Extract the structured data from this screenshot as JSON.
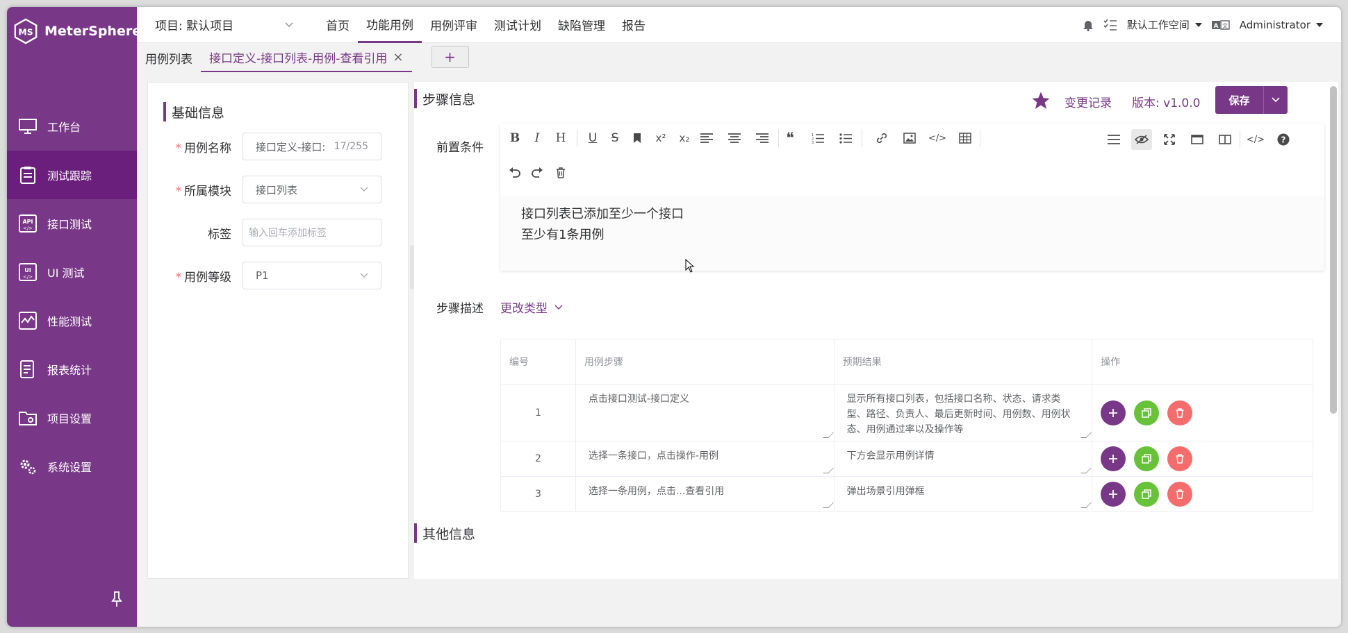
{
  "app": {
    "name": "MeterSphere"
  },
  "sidebar": {
    "items": [
      {
        "label": "工作台"
      },
      {
        "label": "测试跟踪"
      },
      {
        "label": "接口测试"
      },
      {
        "label": "UI 测试"
      },
      {
        "label": "性能测试"
      },
      {
        "label": "报表统计"
      },
      {
        "label": "项目设置"
      },
      {
        "label": "系统设置"
      }
    ]
  },
  "header": {
    "project": "项目: 默认项目",
    "menu": [
      "首页",
      "功能用例",
      "用例评审",
      "测试计划",
      "缺陷管理",
      "报告"
    ],
    "workspace": "默认工作空间",
    "user": "Administrator"
  },
  "tabs": {
    "list": "用例列表",
    "active": "接口定义-接口列表-用例-查看引用",
    "close": "×",
    "add": "+"
  },
  "basic": {
    "title": "基础信息",
    "name_label": "用例名称",
    "name_value": "接口定义-接口:",
    "name_count": "17/255",
    "module_label": "所属模块",
    "module_value": "接口列表",
    "tag_label": "标签",
    "tag_placeholder": "输入回车添加标签",
    "level_label": "用例等级",
    "level_value": "P1",
    "required": "*"
  },
  "steps": {
    "title": "步骤信息",
    "history": "变更记录",
    "version": "版本: v1.0.0",
    "save": "保存",
    "precondition_label": "前置条件",
    "precondition_lines": [
      "接口列表已添加至少一个接口",
      "至少有1条用例"
    ],
    "desc_label": "步骤描述",
    "change_type": "更改类型",
    "columns": [
      "编号",
      "用例步骤",
      "预期结果",
      "操作"
    ],
    "rows": [
      {
        "num": "1",
        "step": "点击接口测试-接口定义",
        "expected": "显示所有接口列表，包括接口名称、状态、请求类型、路径、负责人、最后更新时间、用例数、用例状态、用例通过率以及操作等"
      },
      {
        "num": "2",
        "step": "选择一条接口，点击操作-用例",
        "expected": "下方会显示用例详情"
      },
      {
        "num": "3",
        "step": "选择一条用例，点击...查看引用",
        "expected": "弹出场景引用弹框"
      }
    ]
  },
  "other": {
    "title": "其他信息"
  },
  "toolbar": {
    "bold": "B",
    "italic": "I",
    "heading": "H",
    "underline": "U",
    "strike": "S",
    "sup": "x²",
    "sub": "x₂",
    "quote": "❝",
    "code": "</>"
  },
  "colors": {
    "brand": "#783887",
    "success": "#67c23a",
    "danger": "#f56c6c"
  }
}
